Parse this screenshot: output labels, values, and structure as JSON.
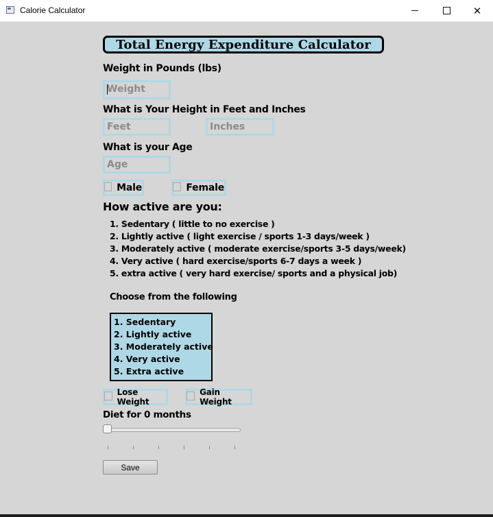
{
  "window": {
    "title": "Calorie Calculator",
    "controls": {
      "minimize": "",
      "maximize": "",
      "close": "✕"
    }
  },
  "heading": "Total Energy Expenditure Calculator",
  "weight": {
    "label": "Weight in Pounds (lbs)",
    "placeholder": "Weight",
    "value": ""
  },
  "height": {
    "label": "What is Your Height in Feet and Inches",
    "feet_placeholder": "Feet",
    "inches_placeholder": "Inches"
  },
  "age": {
    "label": "What is your Age",
    "placeholder": "Age"
  },
  "gender": {
    "male_label": "Male",
    "female_label": "Female",
    "male_checked": false,
    "female_checked": false
  },
  "activity": {
    "heading": "How active are you:",
    "descriptions": [
      "1. Sedentary ( little to no exercise )",
      "2. Lightly active ( light exercise / sports 1-3 days/week )",
      "3. Moderately active ( moderate exercise/sports 3-5 days/week)",
      "4. Very active ( hard exercise/sports 6-7 days a week )",
      "5. extra active ( very hard exercise/ sports and a physical job)"
    ],
    "choose_label": "Choose from the following",
    "options": [
      "1. Sedentary",
      "2. Lightly active",
      "3. Moderately active",
      "4. Very active",
      "5. Extra active"
    ]
  },
  "goal": {
    "lose_label": "Lose Weight",
    "gain_label": "Gain Weight",
    "lose_checked": false,
    "gain_checked": false
  },
  "diet": {
    "label": "Diet for 0 months",
    "slider_value": 0
  },
  "save_label": "Save"
}
